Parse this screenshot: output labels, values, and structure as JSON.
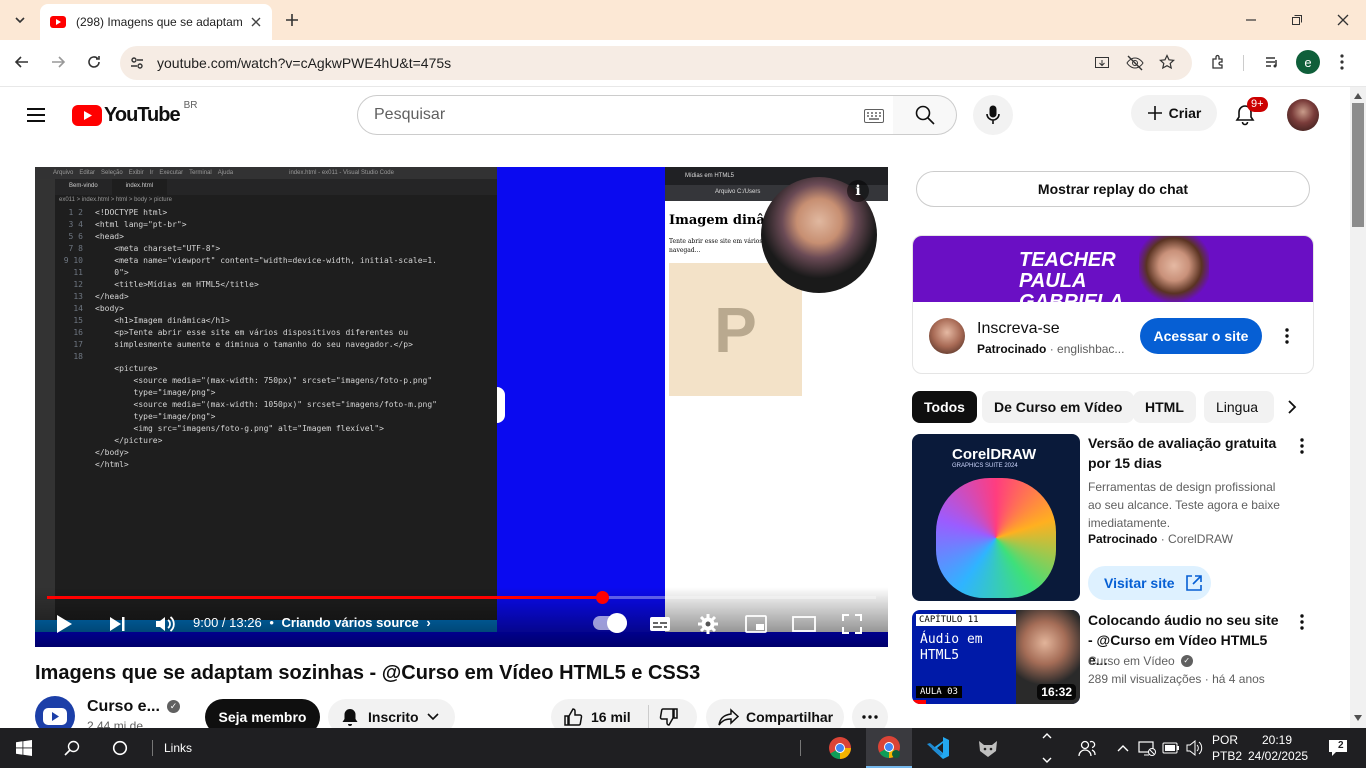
{
  "browser": {
    "tab_title": "(298) Imagens que se adaptam",
    "url": "youtube.com/watch?v=cAgkwPWE4hU&t=475s",
    "profile_initial": "e"
  },
  "youtube": {
    "logo_text": "YouTube",
    "region": "BR",
    "search_placeholder": "Pesquisar",
    "create_label": "Criar",
    "notifications_badge": "9+"
  },
  "video": {
    "time_current": "9:00",
    "time_separator": " / ",
    "time_total": "13:26",
    "chapter": "Criando vários source",
    "progress_fraction": 0.67,
    "editor": {
      "menu": [
        "Arquivo",
        "Editar",
        "Seleção",
        "Exibir",
        "Ir",
        "Executar",
        "Terminal",
        "Ajuda"
      ],
      "window_title": "index.html - ex011 - Visual Studio Code",
      "tabs": [
        "Bem-vindo",
        "index.html"
      ],
      "breadcrumb": "ex011 > index.html > html > body > picture",
      "line_numbers": "1\n2\n3\n4\n5\n\n6\n7\n8\n9\n10\n\n11\n12\n13\n\n14\n\n15\n16\n17\n18",
      "code": "<!DOCTYPE html>\n<html lang=\"pt-br\">\n<head>\n    <meta charset=\"UTF-8\">\n    <meta name=\"viewport\" content=\"width=device-width, initial-scale=1.\n    0\">\n    <title>Mídias em HTML5</title>\n</head>\n<body>\n    <h1>Imagem dinâmica</h1>\n    <p>Tente abrir esse site em vários dispositivos diferentes ou\n    simplesmente aumente e diminua o tamanho do seu navegador.</p>\n\n    <picture>\n        <source media=\"(max-width: 750px)\" srcset=\"imagens/foto-p.png\"\n        type=\"image/png\">\n        <source media=\"(max-width: 1050px)\" srcset=\"imagens/foto-m.png\"\n        type=\"image/png\">\n        <img src=\"imagens/foto-g.png\" alt=\"Imagem flexível\">\n    </picture>\n</body>\n</html>"
    },
    "preview": {
      "tab": "Mídias em HTML5",
      "address": "Arquivo  C:/Users",
      "heading": "Imagem dinâmi",
      "paragraph": "Tente abrir esse site em vários disp... e diminua o tamanho do seu navegad...",
      "image_letter": "P"
    }
  },
  "video_info": {
    "title": "Imagens que se adaptam sozinhas - @Curso em Vídeo HTML5 e CSS3",
    "channel": "Curso e...",
    "subscribers": "2,44 mi de",
    "join_label": "Seja membro",
    "subscribed_label": "Inscrito",
    "likes": "16 mil",
    "share_label": "Compartilhar"
  },
  "sidebar": {
    "replay_chat": "Mostrar replay do chat",
    "ad": {
      "banner_text": "TEACHER PAULA GABRIELA",
      "title": "Inscreva-se",
      "sponsored": "Patrocinado",
      "domain": "englishbac...",
      "cta": "Acessar o site"
    },
    "chips": [
      "Todos",
      "De Curso em Vídeo",
      "HTML",
      "Lingua"
    ],
    "card1": {
      "title": "Versão de avaliação gratuita por 15 dias",
      "desc": "Ferramentas de design profissional ao seu alcance. Teste agora e baixe imediatamente.",
      "sponsored": "Patrocinado",
      "advertiser": "CorelDRAW",
      "cta": "Visitar site",
      "thumb_brand": "CorelDRAW",
      "thumb_sub": "GRAPHICS SUITE 2024"
    },
    "card2": {
      "title": "Colocando áudio no seu site - @Curso em Vídeo HTML5 e...",
      "channel": "Curso em Vídeo",
      "views": "289 mil visualizações",
      "age": "há 4 anos",
      "duration": "16:32",
      "thumb_chapter": "CAPÍTULO 11",
      "thumb_title": "Áudio em HTML5",
      "thumb_lesson": "AULA 03"
    }
  },
  "taskbar": {
    "links_label": "Links",
    "lang": "POR",
    "layout": "PTB2",
    "time": "20:19",
    "date": "24/02/2025",
    "notif_count": "2"
  },
  "colors": {
    "yt_red": "#ff0000",
    "video_blue": "#0000ee",
    "ad_purple": "#6a0fc4",
    "cta_blue": "#065fd4",
    "tabbar": "#fce8d5"
  }
}
